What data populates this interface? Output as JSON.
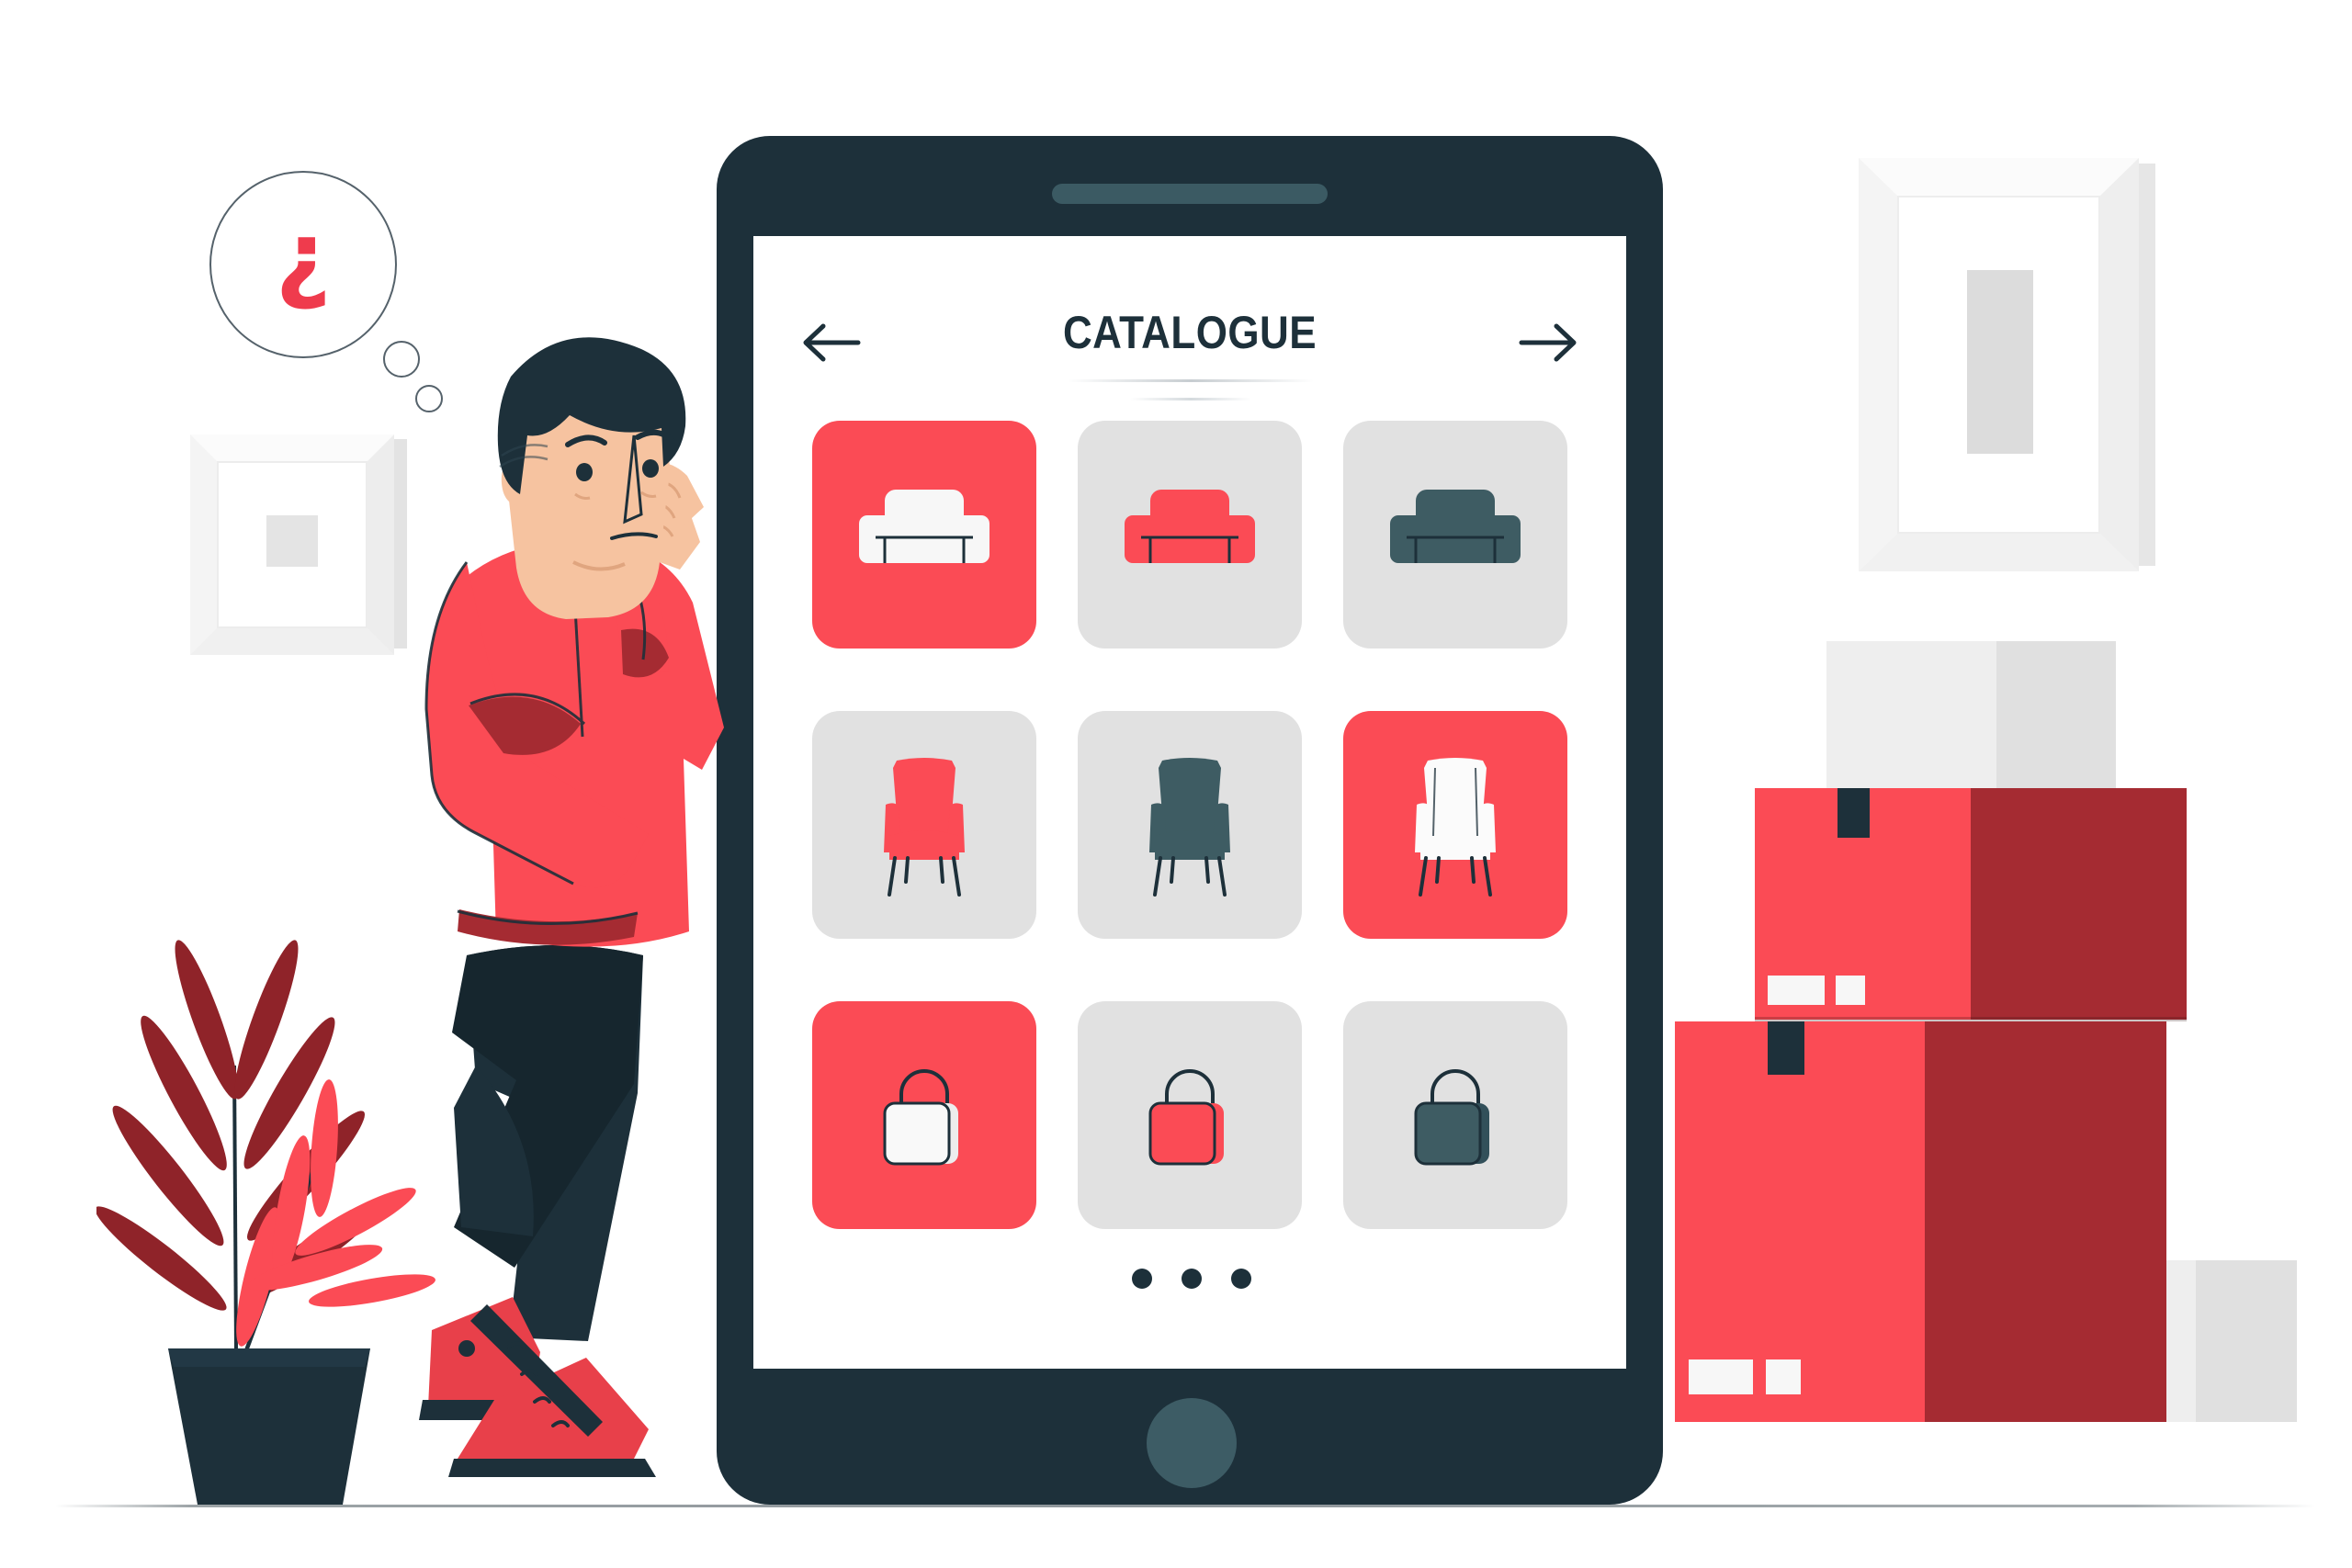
{
  "illustration": {
    "title": "Catalogue concept illustration",
    "background_color": "#ffffff",
    "palette": {
      "accent_red": "#fb4b55",
      "dark_red": "#a52b32",
      "deep_maroon": "#8f2329",
      "dark_navy": "#1d303a",
      "teal_dark": "#3e5c63",
      "tile_gray": "#e1e1e1",
      "frame_white": "#f4f4f4",
      "skin": "#f6c3a0"
    }
  },
  "tablet": {
    "device_name": "tablet-device",
    "speaker_label": "speaker-grille",
    "home_button_label": "home-button",
    "screen": {
      "header": {
        "title": "CATALOGUE",
        "back_icon": "arrow-left-icon",
        "forward_icon": "arrow-right-icon"
      },
      "grid": {
        "rows": 3,
        "columns": 3,
        "tiles": [
          {
            "id": "tile-1",
            "product": "sofa",
            "product_color": "#f7f7f7",
            "tile_color": "#fb4b55",
            "selected": true,
            "label": "White sofa"
          },
          {
            "id": "tile-2",
            "product": "sofa",
            "product_color": "#fb4b55",
            "tile_color": "#e1e1e1",
            "selected": false,
            "label": "Red sofa"
          },
          {
            "id": "tile-3",
            "product": "sofa",
            "product_color": "#3e5c63",
            "tile_color": "#e1e1e1",
            "selected": false,
            "label": "Teal sofa"
          },
          {
            "id": "tile-4",
            "product": "armchair",
            "product_color": "#fb4b55",
            "tile_color": "#e1e1e1",
            "selected": false,
            "label": "Red armchair"
          },
          {
            "id": "tile-5",
            "product": "armchair",
            "product_color": "#3e5c63",
            "tile_color": "#e1e1e1",
            "selected": false,
            "label": "Teal armchair"
          },
          {
            "id": "tile-6",
            "product": "armchair",
            "product_color": "#fbfbfb",
            "tile_color": "#fb4b55",
            "selected": true,
            "label": "White armchair"
          },
          {
            "id": "tile-7",
            "product": "handbag",
            "product_color": "#f7f7f7",
            "tile_color": "#fb4b55",
            "selected": true,
            "label": "White handbag"
          },
          {
            "id": "tile-8",
            "product": "handbag",
            "product_color": "#fb4b55",
            "tile_color": "#e1e1e1",
            "selected": false,
            "label": "Red handbag"
          },
          {
            "id": "tile-9",
            "product": "handbag",
            "product_color": "#3e5c63",
            "tile_color": "#e1e1e1",
            "selected": false,
            "label": "Teal handbag"
          }
        ]
      },
      "pagination": {
        "dot_count": 3,
        "dot_color": "#1d303a",
        "active_index": 0
      }
    }
  },
  "character": {
    "name": "thinking-person",
    "pose": "leaning, hand on chin",
    "sweater_color": "#fb4b55",
    "pants_color": "#1d303a",
    "hair_color": "#1d303a",
    "shoe_color": "#e8404a",
    "thought_bubble": {
      "symbol": "¿",
      "symbol_color": "#ef3b4d",
      "bubble_count": 3
    }
  },
  "decor": {
    "wall_frame_left": {
      "name": "square-picture-frame",
      "shape": "square",
      "inner_color": "#e4e4e4"
    },
    "wall_frame_right": {
      "name": "portrait-picture-frame",
      "shape": "portrait",
      "inner_color": "#dcdcdc"
    },
    "plant": {
      "name": "potted-palm",
      "pot_color": "#1d303a",
      "frond_back_color": "#8f2329",
      "frond_front_color": "#fb4b55"
    },
    "boxes": [
      {
        "name": "box-top-small",
        "face_color": "#efefef",
        "side_color": "#dedede",
        "position": "back-top"
      },
      {
        "name": "box-upper",
        "face_color": "#fb4b55",
        "side_color": "#a52b32",
        "tape_color": "#1d303a",
        "labels": 2
      },
      {
        "name": "box-lower",
        "face_color": "#fb4b55",
        "side_color": "#a52b32",
        "tape_color": "#1d303a",
        "labels": 2
      },
      {
        "name": "box-small-right",
        "face_color": "#efefef",
        "side_color": "#dedede",
        "position": "right-bottom"
      }
    ]
  }
}
